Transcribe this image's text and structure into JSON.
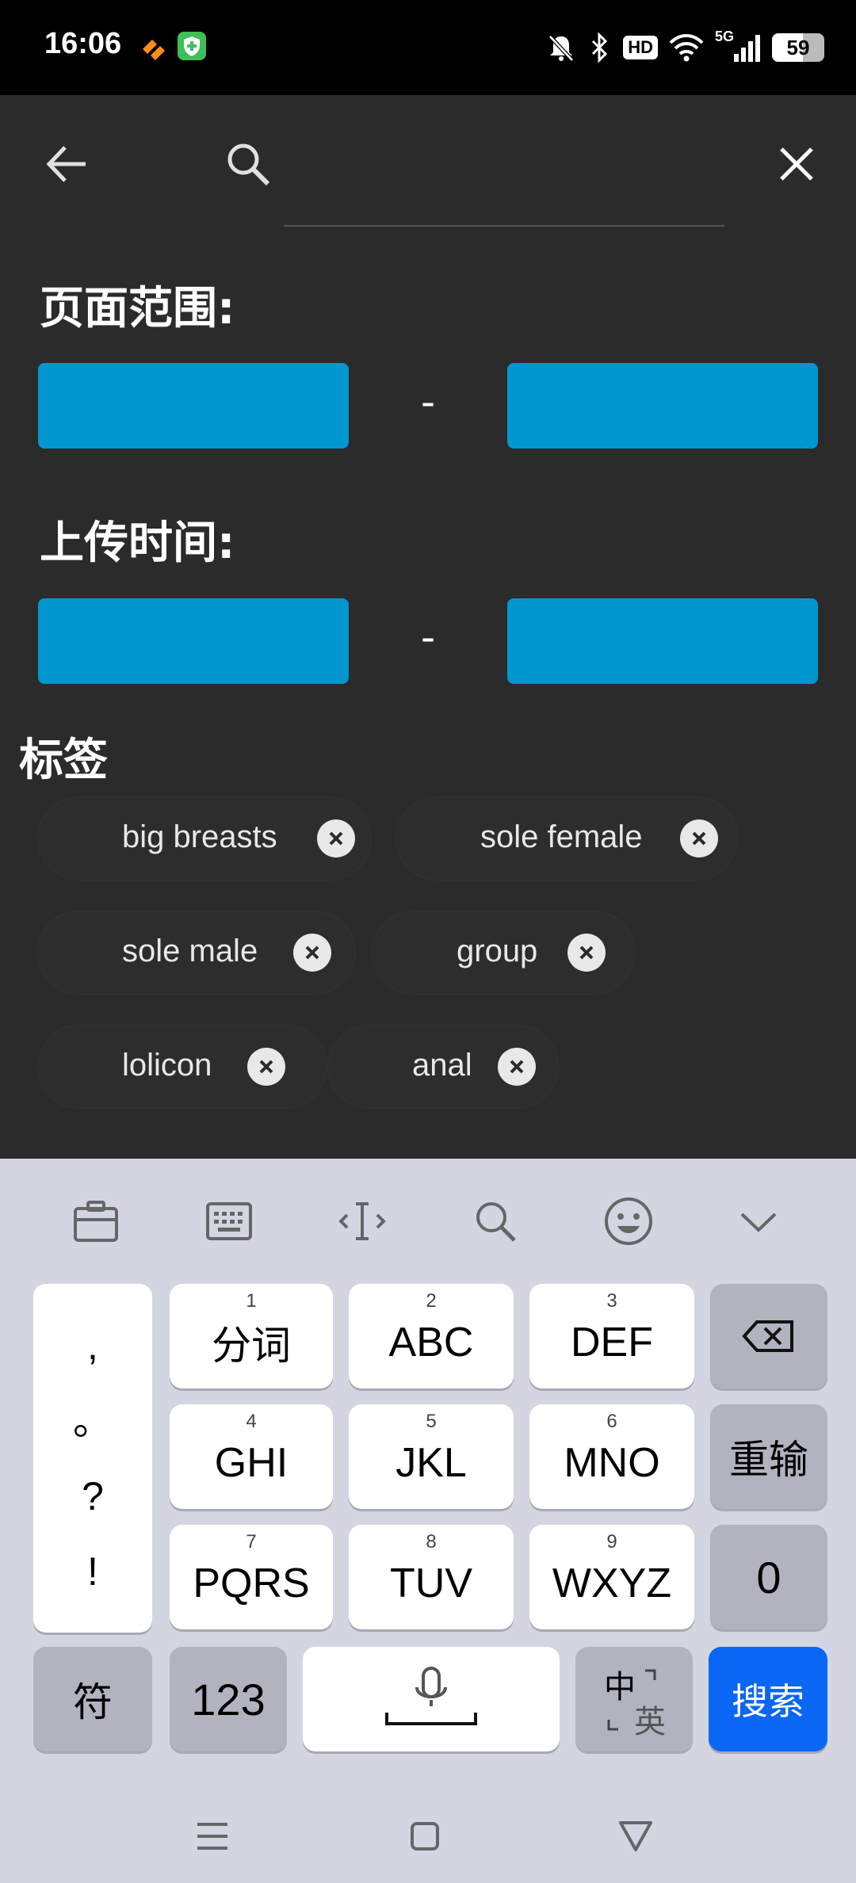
{
  "status_bar": {
    "time": "16:06",
    "hd": "HD",
    "network": "5G",
    "battery": "59",
    "battery_fraction": 0.59
  },
  "toolbar": {
    "search_value": "",
    "icons": [
      "back-arrow-icon",
      "search-icon",
      "close-icon"
    ]
  },
  "page_range": {
    "label": "页面范围:",
    "from_value": "",
    "dash": "-",
    "to_value": ""
  },
  "upload_time": {
    "label": "上传时间:",
    "from_value": "",
    "dash": "-",
    "to_value": ""
  },
  "tags": {
    "label": "标签",
    "items": [
      {
        "label": "big breasts"
      },
      {
        "label": "sole female"
      },
      {
        "label": "sole male"
      },
      {
        "label": "group"
      },
      {
        "label": "lolicon"
      },
      {
        "label": "anal"
      }
    ]
  },
  "keyboard": {
    "toolbar_icons": [
      "clipboard-icon",
      "keyboard-icon",
      "cursor-move-icon",
      "search-icon",
      "emoji-icon",
      "chevron-down-icon"
    ],
    "punct": [
      ",",
      "。",
      "?",
      "!"
    ],
    "keys": [
      {
        "num": "1",
        "label": "分词"
      },
      {
        "num": "2",
        "label": "ABC"
      },
      {
        "num": "3",
        "label": "DEF"
      },
      {
        "num": "4",
        "label": "GHI"
      },
      {
        "num": "5",
        "label": "JKL"
      },
      {
        "num": "6",
        "label": "MNO"
      },
      {
        "num": "7",
        "label": "PQRS"
      },
      {
        "num": "8",
        "label": "TUV"
      },
      {
        "num": "9",
        "label": "WXYZ"
      }
    ],
    "reenter": "重输",
    "zero": "0",
    "symbol": "符",
    "num_mode": "123",
    "lang_top": "中",
    "lang_bottom": "英",
    "search": "搜索",
    "colors": {
      "background": "#d3d6e1",
      "key": "#ffffff",
      "dark_key": "#b1b4bf",
      "accent": "#0a66f5"
    }
  },
  "colors": {
    "page_bg": "#2b2b2b",
    "range_box": "#0096d0"
  }
}
